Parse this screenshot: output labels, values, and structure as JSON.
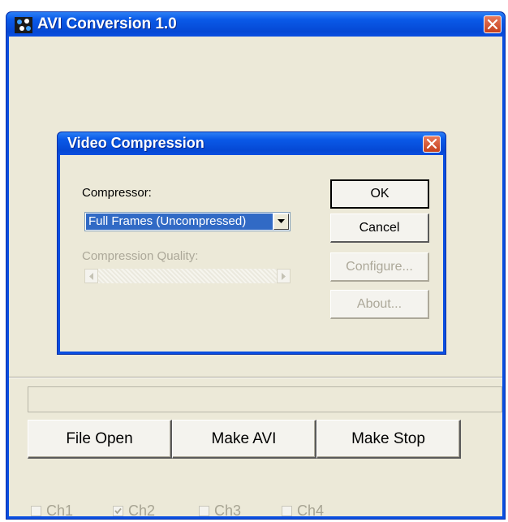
{
  "window": {
    "title": "AVI Conversion 1.0",
    "icons": {
      "app": "avi-app-icon",
      "close": "close-icon"
    }
  },
  "status": {
    "text": ""
  },
  "buttons": {
    "file_open": "File Open",
    "make_avi": "Make AVI",
    "make_stop": "Make Stop"
  },
  "channels": [
    {
      "label": "Ch1",
      "checked": false
    },
    {
      "label": "Ch2",
      "checked": true
    },
    {
      "label": "Ch3",
      "checked": false
    },
    {
      "label": "Ch4",
      "checked": false
    }
  ],
  "dialog": {
    "title": "Video Compression",
    "compressor_label": "Compressor:",
    "compressor_value": "Full Frames (Uncompressed)",
    "quality_label": "Compression Quality:",
    "ok": "OK",
    "cancel": "Cancel",
    "configure": "Configure...",
    "about": "About..."
  },
  "colors": {
    "titlebar": "#0a4ee0",
    "face": "#ece9d8",
    "selection": "#316ac5",
    "close_button": "#d9502b",
    "disabled_text": "#aca899"
  }
}
